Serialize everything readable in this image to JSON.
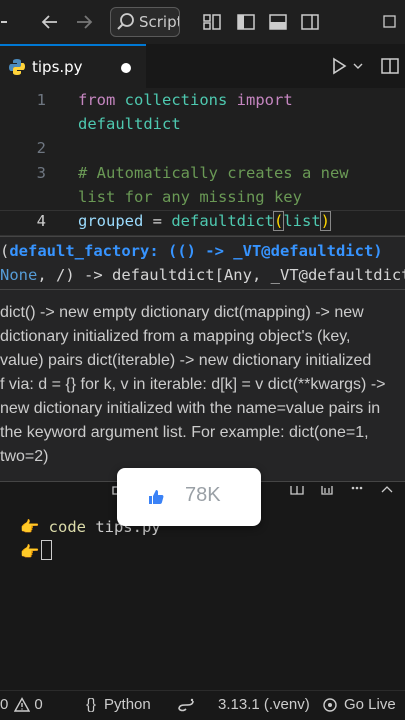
{
  "titlebar": {
    "search_label": "Scripts",
    "icons": [
      "back-arrow-icon",
      "forward-arrow-icon",
      "search-icon",
      "customize-layout-icon",
      "toggle-sidebar-icon",
      "toggle-panel-icon",
      "toggle-secondary-sidebar-icon",
      "maximize-icon"
    ]
  },
  "tab": {
    "filename": "tips.py"
  },
  "editor": {
    "lines": [
      {
        "num": "1",
        "kw1": "from",
        "mod": " collections ",
        "kw2": "import"
      },
      {
        "cont": "defaultdict"
      },
      {
        "num": "2"
      },
      {
        "num": "3",
        "comment": "# Automatically creates a new"
      },
      {
        "comment_cont": "list for any missing key"
      },
      {
        "num": "4",
        "var": "grouped",
        "op": " = ",
        "fn": "defaultdict",
        "paren_open": "(",
        "arg": "list",
        "paren_close": ")"
      }
    ]
  },
  "signature": {
    "line1_open": "(",
    "line1_param": "default_factory: (() -> _VT@defaultdict)",
    "line2_none": "None",
    "line2_rest": ", /) -> defaultdict[Any, _VT@defaultdict]"
  },
  "doc": {
    "lines": [
      "dict() -> new empty dictionary dict(mapping) -> new",
      "dictionary initialized from a mapping object's (key,",
      "value) pairs dict(iterable) -> new dictionary initialized",
      "f via: d = {} for k, v in iterable: d[k] = v dict(**kwargs) ->",
      "new dictionary initialized with the name=value pairs in",
      "the keyword argument list. For example: dict(one=1,",
      "two=2)"
    ]
  },
  "terminal": {
    "prompt": "👉",
    "command": "code",
    "arg": " tips.py"
  },
  "like_overlay": {
    "count": "78K"
  },
  "status": {
    "errors": "0",
    "warnings": "0",
    "language": "Python",
    "interpreter": "3.13.1 (.venv)",
    "go_live": "Go Live"
  },
  "colors": {
    "accent": "#0078d4",
    "keyword": "#c586c0",
    "function": "#4ec9b0",
    "comment": "#6a9955"
  }
}
